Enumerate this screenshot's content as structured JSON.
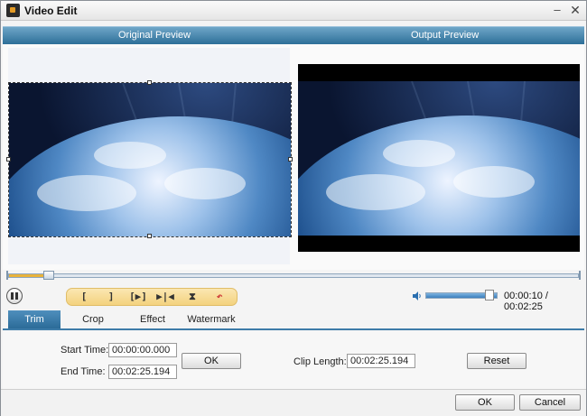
{
  "window": {
    "title": "Video Edit",
    "minimize_label": "–",
    "close_label": "✕"
  },
  "preview": {
    "original_label": "Original Preview",
    "output_label": "Output Preview"
  },
  "timeline": {
    "progress": 0.068
  },
  "toolbar": {
    "tools": [
      {
        "icon": "set-start-icon",
        "glyph": "["
      },
      {
        "icon": "set-end-icon",
        "glyph": "]"
      },
      {
        "icon": "play-selection-icon",
        "glyph": "[▶]"
      },
      {
        "icon": "go-to-marker-icon",
        "glyph": "▶|◀"
      },
      {
        "icon": "merge-icon",
        "glyph": "⧗"
      },
      {
        "icon": "undo-icon",
        "glyph": "↶"
      }
    ]
  },
  "playback": {
    "volume": 0.88,
    "time": "00:00:10 / 00:02:25"
  },
  "tabs": [
    {
      "label": "Trim",
      "active": true
    },
    {
      "label": "Crop",
      "active": false
    },
    {
      "label": "Effect",
      "active": false
    },
    {
      "label": "Watermark",
      "active": false
    }
  ],
  "trim": {
    "start_label": "Start Time:",
    "start_value": "00:00:00.000",
    "end_label": "End Time:",
    "end_value": "00:02:25.194",
    "ok_label": "OK",
    "clip_length_label": "Clip Length:",
    "clip_length_value": "00:02:25.194",
    "reset_label": "Reset"
  },
  "footer": {
    "ok_label": "OK",
    "cancel_label": "Cancel"
  },
  "colors": {
    "accent": "#2d6f98",
    "tool_strip": "#f3d27e",
    "progress": "#e8b23a"
  }
}
